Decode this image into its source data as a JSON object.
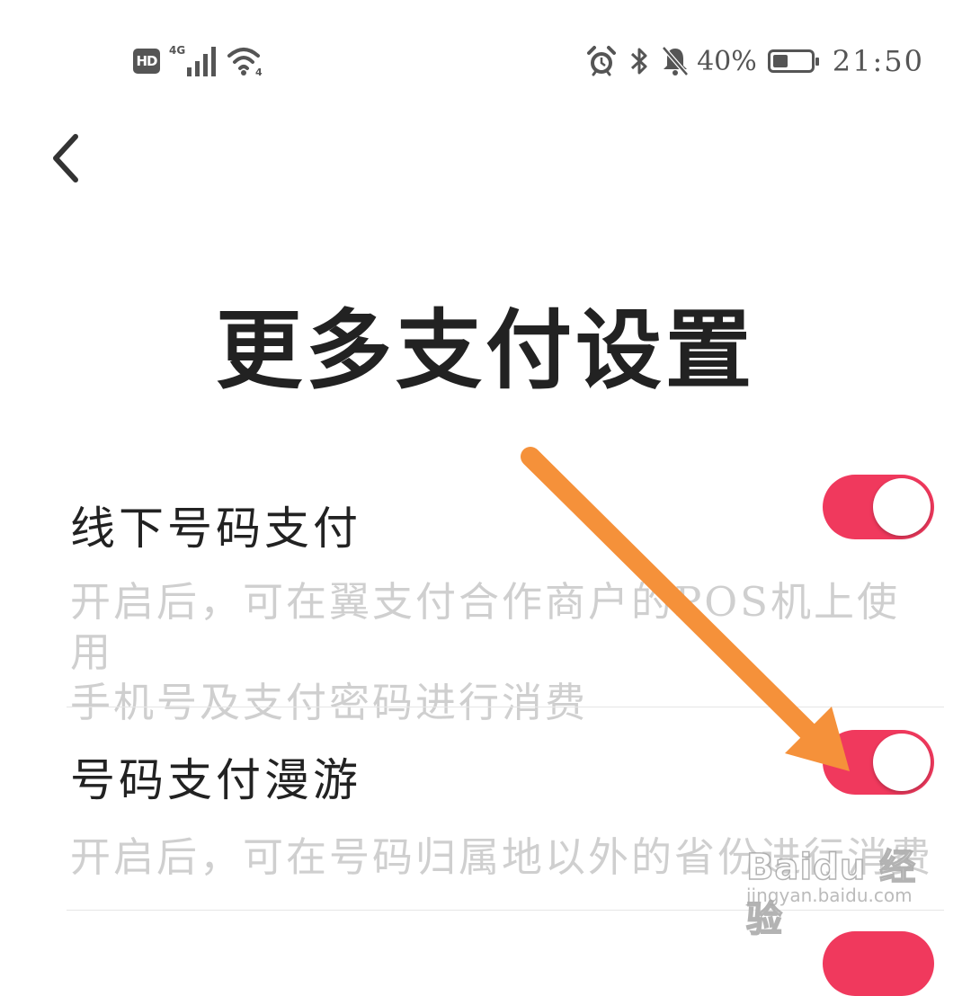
{
  "status_bar": {
    "hd_label": "HD",
    "network_label": "4G",
    "wifi_sub_label": "4",
    "battery_percent_text": "40%",
    "battery_level": 0.4,
    "time": "21:50",
    "icons": [
      "hd-icon",
      "signal-icon",
      "wifi-icon",
      "alarm-icon",
      "bluetooth-icon",
      "bell-muted-icon",
      "battery-icon"
    ]
  },
  "header": {
    "back_icon": "chevron-left-icon",
    "title": "更多支付设置"
  },
  "settings": [
    {
      "label": "线下号码支付",
      "description_line1": "开启后，可在翼支付合作商户的POS机上使用",
      "description_line2": "手机号及支付密码进行消费",
      "enabled": true
    },
    {
      "label": "号码支付漫游",
      "description_line1": "开启后，可在号码归属地以外的省份进行消费",
      "enabled": true
    }
  ],
  "watermark": {
    "brand": "Baidu 经验",
    "url": "jingyan.baidu.com"
  },
  "colors": {
    "toggle_on": "#f0395d",
    "annotation_arrow": "#f5913a",
    "description_text": "#cfcfcf",
    "title_text": "#222222"
  }
}
